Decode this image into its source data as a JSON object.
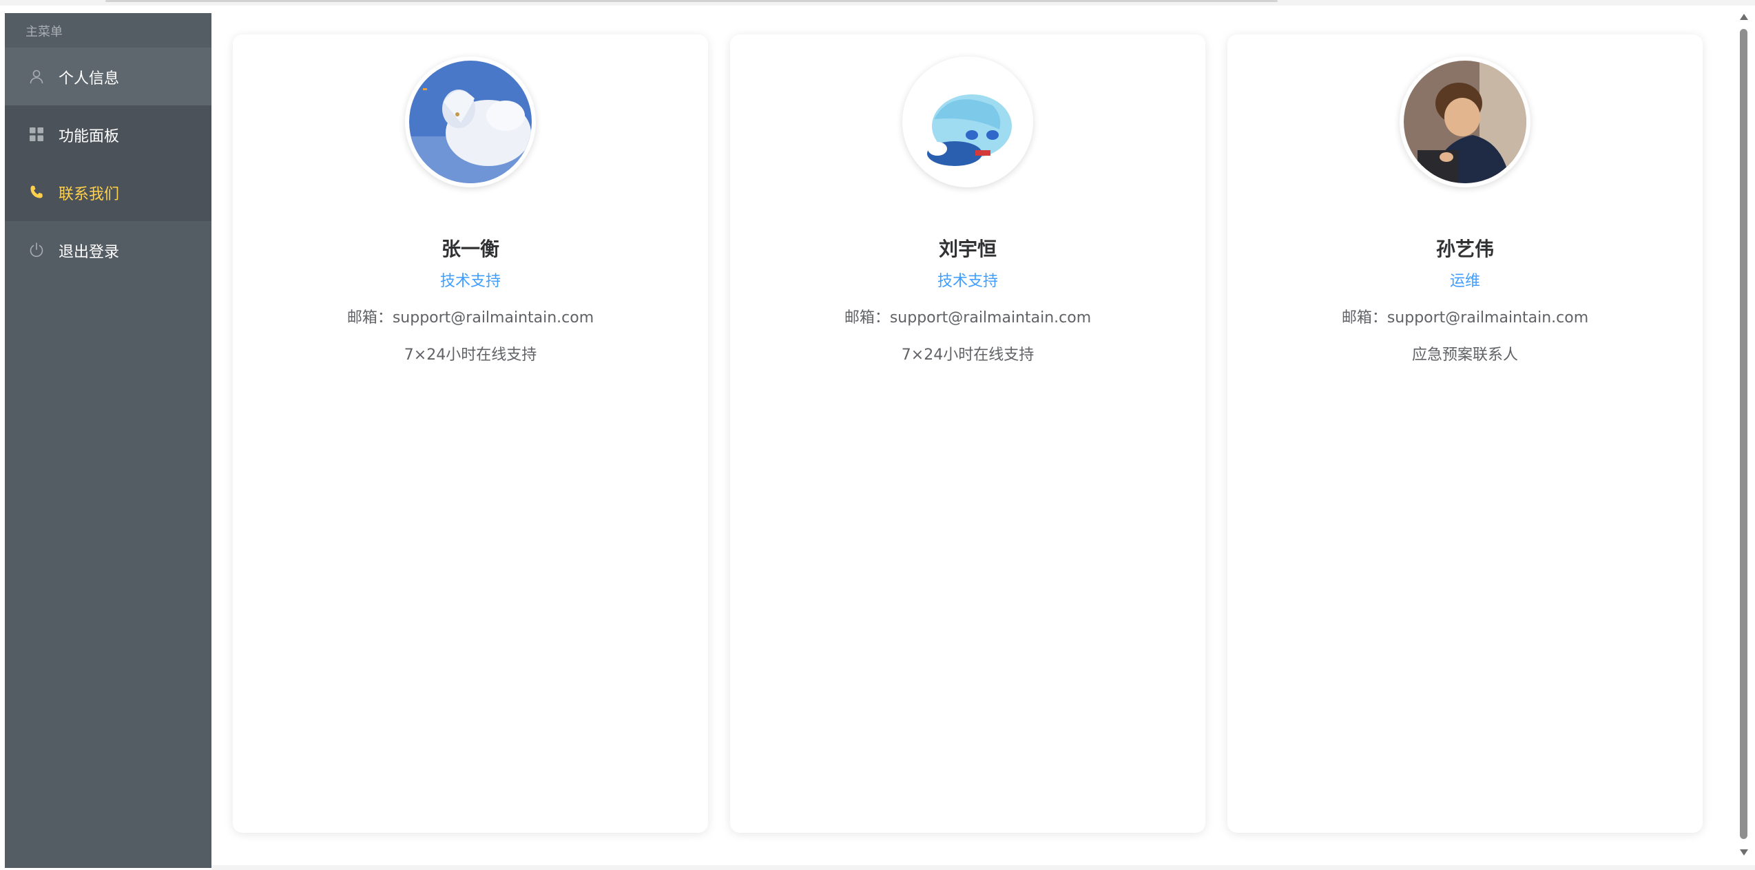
{
  "sidebar": {
    "group_title": "主菜单",
    "items": [
      {
        "label": "个人信息",
        "icon": "user-icon"
      },
      {
        "label": "功能面板",
        "icon": "grid-icon"
      },
      {
        "label": "联系我们",
        "icon": "phone-icon",
        "active": true
      },
      {
        "label": "退出登录",
        "icon": "power-icon"
      }
    ],
    "active_color": "#ffd04b",
    "background": "#545c64"
  },
  "contacts": [
    {
      "name": "张一衡",
      "role": "技术支持",
      "email": "邮箱：support@railmaintain.com",
      "note": "7×24小时在线支持"
    },
    {
      "name": "刘宇恒",
      "role": "技术支持",
      "email": "邮箱：support@railmaintain.com",
      "note": "7×24小时在线支持"
    },
    {
      "name": "孙艺伟",
      "role": "运维",
      "email": "邮箱：support@railmaintain.com",
      "note": "应急预案联系人"
    }
  ],
  "colors": {
    "role": "#409eff",
    "name": "#303133",
    "text": "#606266"
  }
}
